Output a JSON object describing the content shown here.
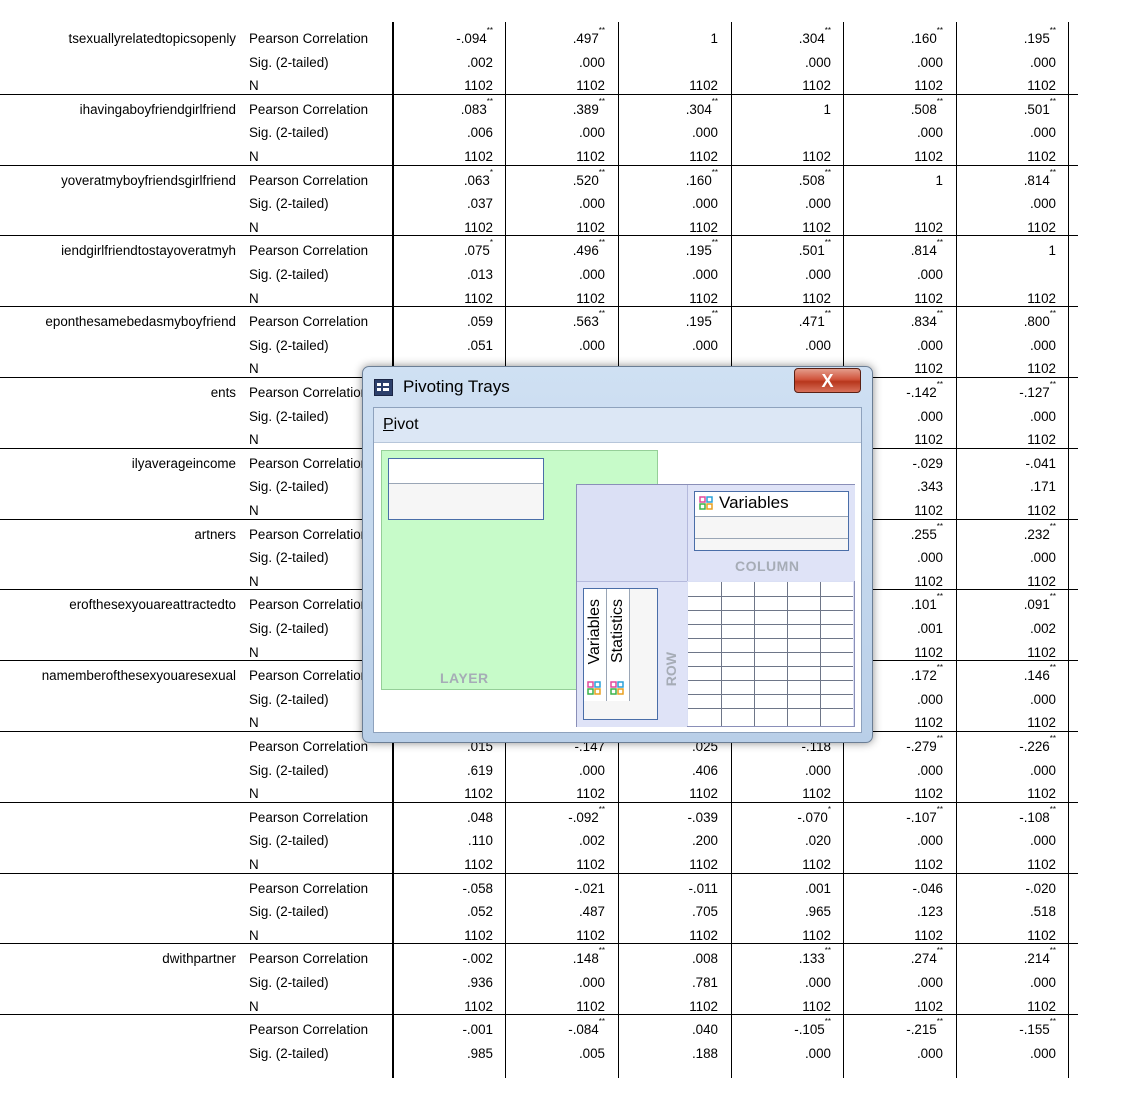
{
  "table": {
    "stat_labels": [
      "Pearson Correlation",
      "Sig. (2-tailed)",
      "N"
    ],
    "blocks": [
      {
        "var": "tsexuallyrelatedtopicsopenly",
        "corr": [
          "-.094**",
          ".497**",
          "1",
          ".304**",
          ".160**",
          ".195**"
        ],
        "sig": [
          ".002",
          ".000",
          "",
          ".000",
          ".000",
          ".000"
        ],
        "n": [
          "1102",
          "1102",
          "1102",
          "1102",
          "1102",
          "1102"
        ]
      },
      {
        "var": "ihavingaboyfriendgirlfriend",
        "corr": [
          ".083**",
          ".389**",
          ".304**",
          "1",
          ".508**",
          ".501**"
        ],
        "sig": [
          ".006",
          ".000",
          ".000",
          "",
          ".000",
          ".000"
        ],
        "n": [
          "1102",
          "1102",
          "1102",
          "1102",
          "1102",
          "1102"
        ]
      },
      {
        "var": "yoveratmyboyfriendsgirlfriend",
        "corr": [
          ".063*",
          ".520**",
          ".160**",
          ".508**",
          "1",
          ".814**"
        ],
        "sig": [
          ".037",
          ".000",
          ".000",
          ".000",
          "",
          ".000"
        ],
        "n": [
          "1102",
          "1102",
          "1102",
          "1102",
          "1102",
          "1102"
        ]
      },
      {
        "var": "iendgirlfriendtostayoveratmyh",
        "corr": [
          ".075*",
          ".496**",
          ".195**",
          ".501**",
          ".814**",
          "1"
        ],
        "sig": [
          ".013",
          ".000",
          ".000",
          ".000",
          ".000",
          ""
        ],
        "n": [
          "1102",
          "1102",
          "1102",
          "1102",
          "1102",
          "1102"
        ]
      },
      {
        "var": "eponthesamebedasmyboyfriend",
        "corr": [
          ".059",
          ".563**",
          ".195**",
          ".471**",
          ".834**",
          ".800**"
        ],
        "sig": [
          ".051",
          ".000",
          ".000",
          ".000",
          ".000",
          ".000"
        ],
        "n": [
          "",
          "",
          "",
          "",
          "1102",
          "1102"
        ]
      },
      {
        "var": "ents",
        "corr": [
          "",
          "",
          "",
          "",
          "-.142**",
          "-.127**"
        ],
        "sig": [
          "",
          "",
          "",
          "",
          ".000",
          ".000"
        ],
        "n": [
          "",
          "",
          "",
          "",
          "1102",
          "1102"
        ]
      },
      {
        "var": "ilyaverageincome",
        "corr": [
          "",
          "",
          "",
          "",
          "-.029",
          "-.041"
        ],
        "sig": [
          "",
          "",
          "",
          "",
          ".343",
          ".171"
        ],
        "n": [
          "",
          "",
          "",
          "",
          "1102",
          "1102"
        ]
      },
      {
        "var": "artners",
        "corr": [
          "",
          "",
          "",
          "",
          ".255**",
          ".232**"
        ],
        "sig": [
          "",
          "",
          "",
          "",
          ".000",
          ".000"
        ],
        "n": [
          "",
          "",
          "",
          "",
          "1102",
          "1102"
        ]
      },
      {
        "var": "erofthesexyouareattractedto",
        "corr": [
          "",
          "",
          "",
          "",
          ".101**",
          ".091**"
        ],
        "sig": [
          "",
          "",
          "",
          "",
          ".001",
          ".002"
        ],
        "n": [
          "",
          "",
          "",
          "",
          "1102",
          "1102"
        ]
      },
      {
        "var": "namemberofthesexyouaresexual",
        "corr": [
          "",
          "",
          "",
          "",
          ".172**",
          ".146**"
        ],
        "sig": [
          "",
          "",
          "",
          "",
          ".000",
          ".000"
        ],
        "n": [
          "",
          "",
          "",
          "",
          "1102",
          "1102"
        ]
      },
      {
        "var": "",
        "corr": [
          ".015",
          "-.147",
          ".025",
          "-.118",
          "-.279**",
          "-.226**"
        ],
        "sig": [
          ".619",
          ".000",
          ".406",
          ".000",
          ".000",
          ".000"
        ],
        "n": [
          "1102",
          "1102",
          "1102",
          "1102",
          "1102",
          "1102"
        ]
      },
      {
        "var": "",
        "corr": [
          ".048",
          "-.092**",
          "-.039",
          "-.070*",
          "-.107**",
          "-.108**"
        ],
        "sig": [
          ".110",
          ".002",
          ".200",
          ".020",
          ".000",
          ".000"
        ],
        "n": [
          "1102",
          "1102",
          "1102",
          "1102",
          "1102",
          "1102"
        ]
      },
      {
        "var": "",
        "corr": [
          "-.058",
          "-.021",
          "-.011",
          ".001",
          "-.046",
          "-.020"
        ],
        "sig": [
          ".052",
          ".487",
          ".705",
          ".965",
          ".123",
          ".518"
        ],
        "n": [
          "1102",
          "1102",
          "1102",
          "1102",
          "1102",
          "1102"
        ]
      },
      {
        "var": "dwithpartner",
        "corr": [
          "-.002",
          ".148**",
          ".008",
          ".133**",
          ".274**",
          ".214**"
        ],
        "sig": [
          ".936",
          ".000",
          ".781",
          ".000",
          ".000",
          ".000"
        ],
        "n": [
          "1102",
          "1102",
          "1102",
          "1102",
          "1102",
          "1102"
        ]
      },
      {
        "var": "",
        "corr": [
          "-.001",
          "-.084**",
          ".040",
          "-.105**",
          "-.215**",
          "-.155**"
        ],
        "sig": [
          ".985",
          ".005",
          ".188",
          ".000",
          ".000",
          ".000"
        ],
        "n": []
      }
    ]
  },
  "dialog": {
    "title": "Pivoting Trays",
    "close_label": "X",
    "menu_mnemonic": "P",
    "menu_rest": "ivot",
    "layer_label": "LAYER",
    "column_label": "COLUMN",
    "row_label": "ROW",
    "column_items": [
      "Variables"
    ],
    "row_items": [
      "Variables",
      "Statistics"
    ],
    "icons": {
      "app": "spss-table-icon",
      "variable": "pivot-variable-icon"
    },
    "colors": {
      "layer_tray": "#c7fbc9",
      "pivot_tray": "#dbe0f5",
      "close_button": "#c8462c"
    }
  }
}
